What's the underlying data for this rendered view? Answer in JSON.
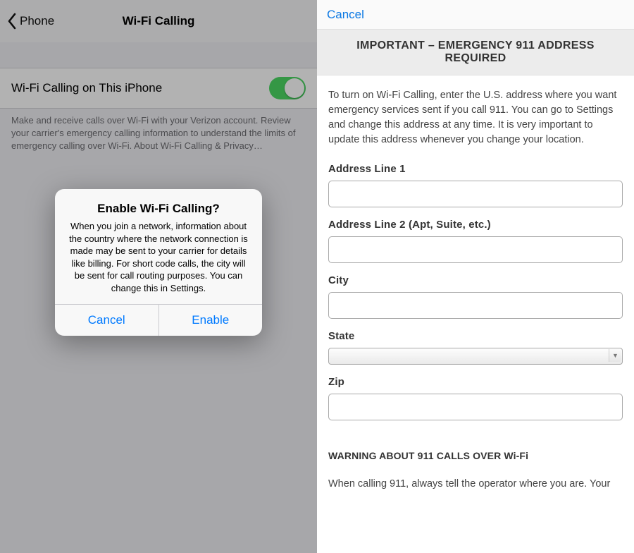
{
  "left": {
    "back_label": "Phone",
    "title": "Wi-Fi Calling",
    "toggle_label": "Wi-Fi Calling on This iPhone",
    "toggle_on": true,
    "footer_text": "Make and receive calls over Wi-Fi with your Verizon account. Review your carrier's emergency calling information to understand the limits of emergency calling over Wi-Fi. ",
    "footer_link": "About Wi-Fi Calling & Privacy…",
    "dialog": {
      "title": "Enable Wi-Fi Calling?",
      "message": "When you join a network, information about the country where the network connection is made may be sent to your carrier for details like billing. For short code calls, the city will be sent for call routing purposes. You can change this in Settings.",
      "cancel": "Cancel",
      "confirm": "Enable"
    }
  },
  "right": {
    "cancel": "Cancel",
    "banner": "IMPORTANT – EMERGENCY 911 ADDRESS REQUIRED",
    "intro": "To turn on Wi-Fi Calling, enter the U.S. address where you want emergency services sent if you call 911. You can go to Settings and change this address at any time. It is very important to update this address whenever you change your location.",
    "fields": {
      "addr1": {
        "label": "Address Line 1",
        "value": ""
      },
      "addr2": {
        "label": "Address Line 2 (Apt, Suite, etc.)",
        "value": ""
      },
      "city": {
        "label": "City",
        "value": ""
      },
      "state": {
        "label": "State",
        "value": ""
      },
      "zip": {
        "label": "Zip",
        "value": ""
      }
    },
    "warning_heading": "WARNING ABOUT 911 CALLS OVER Wi-Fi",
    "warning_body": "When calling 911, always tell the operator where you are. Your"
  }
}
